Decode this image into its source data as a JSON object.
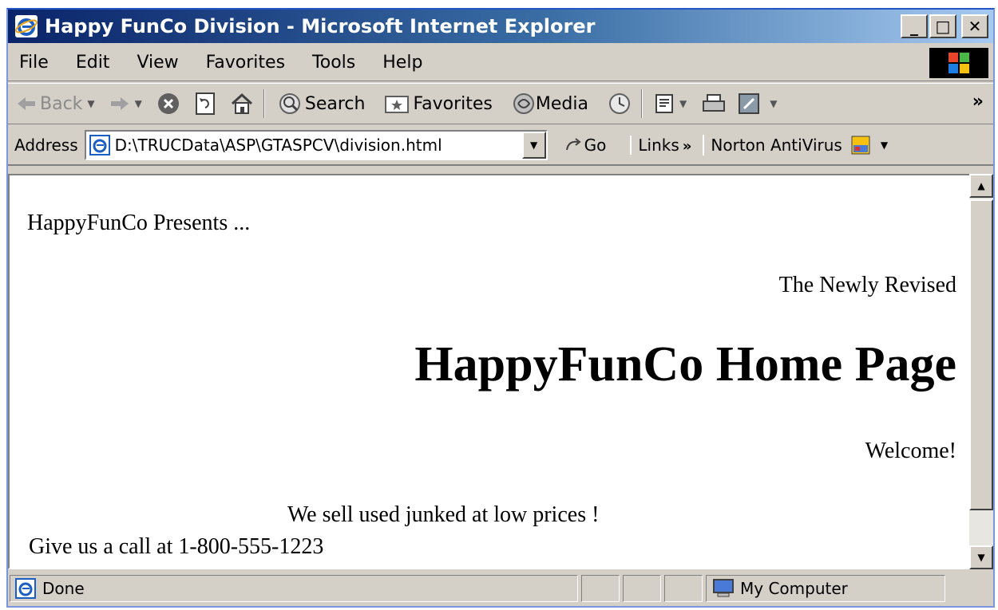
{
  "window": {
    "title": "Happy FunCo Division - Microsoft Internet Explorer",
    "minimize_label": "_",
    "maximize_label": "□",
    "close_label": "✕"
  },
  "menu": {
    "items": [
      {
        "label": "File"
      },
      {
        "label": "Edit"
      },
      {
        "label": "View"
      },
      {
        "label": "Favorites"
      },
      {
        "label": "Tools"
      },
      {
        "label": "Help"
      }
    ]
  },
  "toolbar": {
    "back_label": "Back",
    "search_label": "Search",
    "favorites_label": "Favorites",
    "media_label": "Media",
    "more_label": "»"
  },
  "address_bar": {
    "label": "Address",
    "value": "D:\\TRUCData\\ASP\\GTASPCV\\division.html",
    "go_label": "Go",
    "links_label": "Links",
    "links_more": "»",
    "norton_label": "Norton AntiVirus"
  },
  "page": {
    "presents": "HappyFunCo Presents ...",
    "revised": "The Newly Revised",
    "headline": "HappyFunCo Home Page",
    "welcome": "Welcome!",
    "sell": "We sell used junked at low prices !",
    "call": "Give us a call at 1-800-555-1223"
  },
  "status": {
    "text": "Done",
    "zone": "My Computer"
  },
  "colors": {
    "titlebar_start": "#0a246a",
    "titlebar_end": "#a6caf0",
    "chrome": "#d4d0c8"
  }
}
